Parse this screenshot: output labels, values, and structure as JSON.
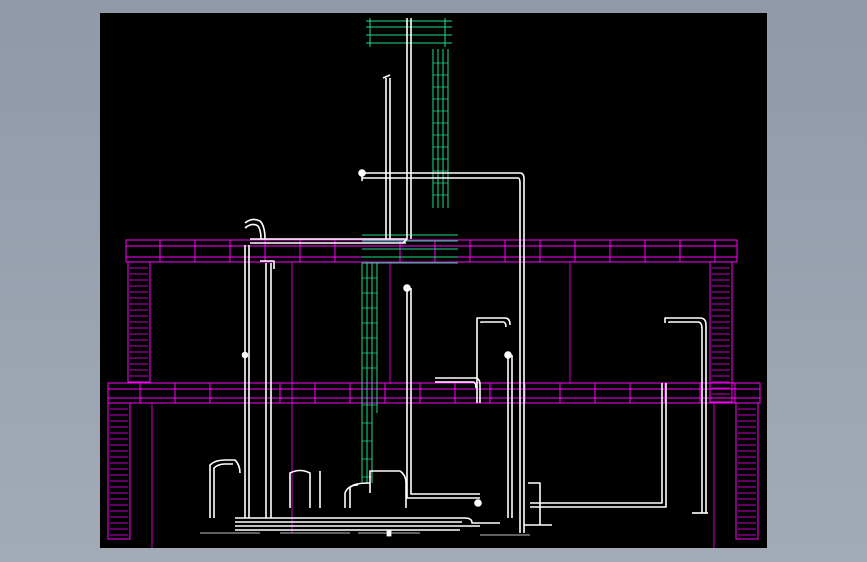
{
  "viewer": {
    "background_color": "#9aa3b0",
    "canvas_color": "#000000"
  },
  "drawing": {
    "type": "piping-elevation-cad",
    "layer_colors": {
      "structure": "#ff00ff",
      "piping": "#ffffff",
      "ductwork": "#22dd88"
    }
  }
}
